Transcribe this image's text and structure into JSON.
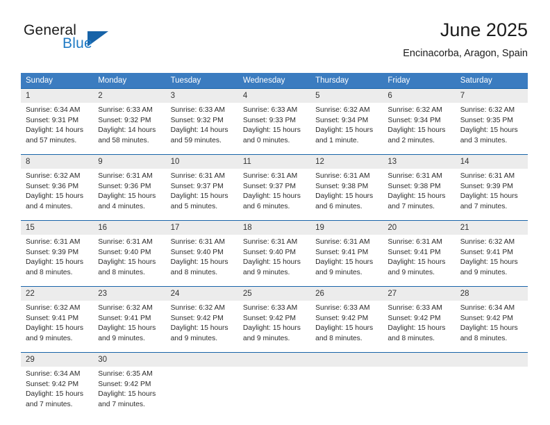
{
  "brand": {
    "name_top": "General",
    "name_bottom": "Blue",
    "accent_color": "#1f7ac4",
    "triangle_color": "#1763a8"
  },
  "header": {
    "title": "June 2025",
    "location": "Encinacorba, Aragon, Spain"
  },
  "theme": {
    "header_band": "#3b7cc0",
    "row_divider": "#1763a8",
    "daynum_band": "#ececec"
  },
  "weekday_headers": [
    "Sunday",
    "Monday",
    "Tuesday",
    "Wednesday",
    "Thursday",
    "Friday",
    "Saturday"
  ],
  "weeks": [
    [
      {
        "day": "1",
        "sunrise": "Sunrise: 6:34 AM",
        "sunset": "Sunset: 9:31 PM",
        "daylight1": "Daylight: 14 hours",
        "daylight2": "and 57 minutes."
      },
      {
        "day": "2",
        "sunrise": "Sunrise: 6:33 AM",
        "sunset": "Sunset: 9:32 PM",
        "daylight1": "Daylight: 14 hours",
        "daylight2": "and 58 minutes."
      },
      {
        "day": "3",
        "sunrise": "Sunrise: 6:33 AM",
        "sunset": "Sunset: 9:32 PM",
        "daylight1": "Daylight: 14 hours",
        "daylight2": "and 59 minutes."
      },
      {
        "day": "4",
        "sunrise": "Sunrise: 6:33 AM",
        "sunset": "Sunset: 9:33 PM",
        "daylight1": "Daylight: 15 hours",
        "daylight2": "and 0 minutes."
      },
      {
        "day": "5",
        "sunrise": "Sunrise: 6:32 AM",
        "sunset": "Sunset: 9:34 PM",
        "daylight1": "Daylight: 15 hours",
        "daylight2": "and 1 minute."
      },
      {
        "day": "6",
        "sunrise": "Sunrise: 6:32 AM",
        "sunset": "Sunset: 9:34 PM",
        "daylight1": "Daylight: 15 hours",
        "daylight2": "and 2 minutes."
      },
      {
        "day": "7",
        "sunrise": "Sunrise: 6:32 AM",
        "sunset": "Sunset: 9:35 PM",
        "daylight1": "Daylight: 15 hours",
        "daylight2": "and 3 minutes."
      }
    ],
    [
      {
        "day": "8",
        "sunrise": "Sunrise: 6:32 AM",
        "sunset": "Sunset: 9:36 PM",
        "daylight1": "Daylight: 15 hours",
        "daylight2": "and 4 minutes."
      },
      {
        "day": "9",
        "sunrise": "Sunrise: 6:31 AM",
        "sunset": "Sunset: 9:36 PM",
        "daylight1": "Daylight: 15 hours",
        "daylight2": "and 4 minutes."
      },
      {
        "day": "10",
        "sunrise": "Sunrise: 6:31 AM",
        "sunset": "Sunset: 9:37 PM",
        "daylight1": "Daylight: 15 hours",
        "daylight2": "and 5 minutes."
      },
      {
        "day": "11",
        "sunrise": "Sunrise: 6:31 AM",
        "sunset": "Sunset: 9:37 PM",
        "daylight1": "Daylight: 15 hours",
        "daylight2": "and 6 minutes."
      },
      {
        "day": "12",
        "sunrise": "Sunrise: 6:31 AM",
        "sunset": "Sunset: 9:38 PM",
        "daylight1": "Daylight: 15 hours",
        "daylight2": "and 6 minutes."
      },
      {
        "day": "13",
        "sunrise": "Sunrise: 6:31 AM",
        "sunset": "Sunset: 9:38 PM",
        "daylight1": "Daylight: 15 hours",
        "daylight2": "and 7 minutes."
      },
      {
        "day": "14",
        "sunrise": "Sunrise: 6:31 AM",
        "sunset": "Sunset: 9:39 PM",
        "daylight1": "Daylight: 15 hours",
        "daylight2": "and 7 minutes."
      }
    ],
    [
      {
        "day": "15",
        "sunrise": "Sunrise: 6:31 AM",
        "sunset": "Sunset: 9:39 PM",
        "daylight1": "Daylight: 15 hours",
        "daylight2": "and 8 minutes."
      },
      {
        "day": "16",
        "sunrise": "Sunrise: 6:31 AM",
        "sunset": "Sunset: 9:40 PM",
        "daylight1": "Daylight: 15 hours",
        "daylight2": "and 8 minutes."
      },
      {
        "day": "17",
        "sunrise": "Sunrise: 6:31 AM",
        "sunset": "Sunset: 9:40 PM",
        "daylight1": "Daylight: 15 hours",
        "daylight2": "and 8 minutes."
      },
      {
        "day": "18",
        "sunrise": "Sunrise: 6:31 AM",
        "sunset": "Sunset: 9:40 PM",
        "daylight1": "Daylight: 15 hours",
        "daylight2": "and 9 minutes."
      },
      {
        "day": "19",
        "sunrise": "Sunrise: 6:31 AM",
        "sunset": "Sunset: 9:41 PM",
        "daylight1": "Daylight: 15 hours",
        "daylight2": "and 9 minutes."
      },
      {
        "day": "20",
        "sunrise": "Sunrise: 6:31 AM",
        "sunset": "Sunset: 9:41 PM",
        "daylight1": "Daylight: 15 hours",
        "daylight2": "and 9 minutes."
      },
      {
        "day": "21",
        "sunrise": "Sunrise: 6:32 AM",
        "sunset": "Sunset: 9:41 PM",
        "daylight1": "Daylight: 15 hours",
        "daylight2": "and 9 minutes."
      }
    ],
    [
      {
        "day": "22",
        "sunrise": "Sunrise: 6:32 AM",
        "sunset": "Sunset: 9:41 PM",
        "daylight1": "Daylight: 15 hours",
        "daylight2": "and 9 minutes."
      },
      {
        "day": "23",
        "sunrise": "Sunrise: 6:32 AM",
        "sunset": "Sunset: 9:41 PM",
        "daylight1": "Daylight: 15 hours",
        "daylight2": "and 9 minutes."
      },
      {
        "day": "24",
        "sunrise": "Sunrise: 6:32 AM",
        "sunset": "Sunset: 9:42 PM",
        "daylight1": "Daylight: 15 hours",
        "daylight2": "and 9 minutes."
      },
      {
        "day": "25",
        "sunrise": "Sunrise: 6:33 AM",
        "sunset": "Sunset: 9:42 PM",
        "daylight1": "Daylight: 15 hours",
        "daylight2": "and 9 minutes."
      },
      {
        "day": "26",
        "sunrise": "Sunrise: 6:33 AM",
        "sunset": "Sunset: 9:42 PM",
        "daylight1": "Daylight: 15 hours",
        "daylight2": "and 8 minutes."
      },
      {
        "day": "27",
        "sunrise": "Sunrise: 6:33 AM",
        "sunset": "Sunset: 9:42 PM",
        "daylight1": "Daylight: 15 hours",
        "daylight2": "and 8 minutes."
      },
      {
        "day": "28",
        "sunrise": "Sunrise: 6:34 AM",
        "sunset": "Sunset: 9:42 PM",
        "daylight1": "Daylight: 15 hours",
        "daylight2": "and 8 minutes."
      }
    ],
    [
      {
        "day": "29",
        "sunrise": "Sunrise: 6:34 AM",
        "sunset": "Sunset: 9:42 PM",
        "daylight1": "Daylight: 15 hours",
        "daylight2": "and 7 minutes."
      },
      {
        "day": "30",
        "sunrise": "Sunrise: 6:35 AM",
        "sunset": "Sunset: 9:42 PM",
        "daylight1": "Daylight: 15 hours",
        "daylight2": "and 7 minutes."
      },
      {
        "day": "",
        "sunrise": "",
        "sunset": "",
        "daylight1": "",
        "daylight2": ""
      },
      {
        "day": "",
        "sunrise": "",
        "sunset": "",
        "daylight1": "",
        "daylight2": ""
      },
      {
        "day": "",
        "sunrise": "",
        "sunset": "",
        "daylight1": "",
        "daylight2": ""
      },
      {
        "day": "",
        "sunrise": "",
        "sunset": "",
        "daylight1": "",
        "daylight2": ""
      },
      {
        "day": "",
        "sunrise": "",
        "sunset": "",
        "daylight1": "",
        "daylight2": ""
      }
    ]
  ]
}
